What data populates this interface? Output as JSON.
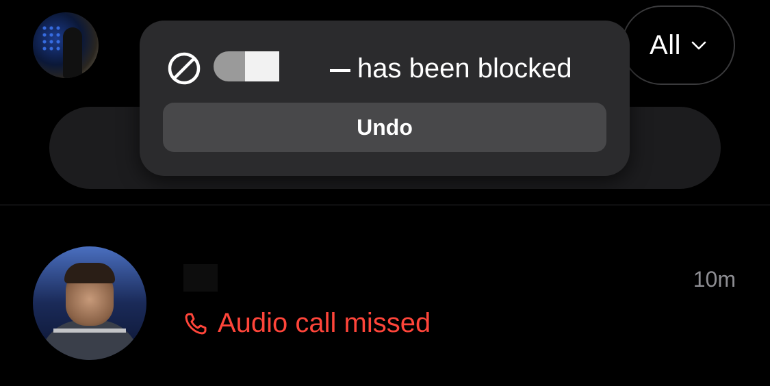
{
  "header": {
    "filter": {
      "label": "All",
      "icon": "chevron-down-icon"
    }
  },
  "toast": {
    "icon": "blocked-icon",
    "message_suffix": "has been blocked",
    "undo_label": "Undo"
  },
  "conversations": [
    {
      "time": "10m",
      "preview_icon": "phone-icon",
      "preview": "Audio call missed"
    }
  ],
  "colors": {
    "background": "#000000",
    "toast_bg": "#2b2b2d",
    "undo_bg": "#48484a",
    "missed_call": "#ff453a",
    "secondary_text": "#8e8e93"
  }
}
